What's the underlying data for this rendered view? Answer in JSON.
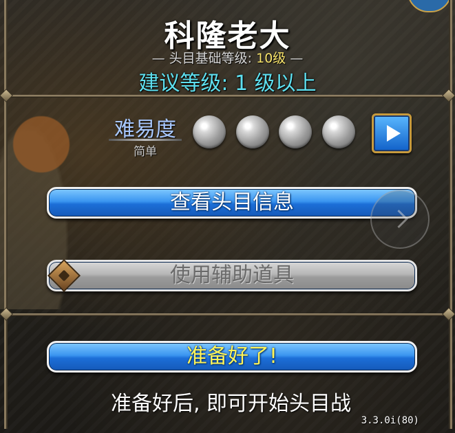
{
  "header": {
    "title": "科隆老大",
    "base_level_label": "头目基础等级:",
    "base_level_value": "10级",
    "recommend_text": "建议等级: 1 级以上"
  },
  "difficulty": {
    "label": "难易度",
    "value": "简单",
    "levels_total": 4,
    "levels_active": 0
  },
  "buttons": {
    "boss_info": "查看头目信息",
    "use_item": "使用辅助道具",
    "ready": "准备好了!"
  },
  "hint": "准备好后, 即可开始头目战",
  "version": "3.3.0i(80)",
  "colors": {
    "title": "#ffffff",
    "level_highlight": "#f7e36a",
    "recommend": "#5ee0f0",
    "button_blue": "#1c6fd8",
    "ready_text": "#fff45a"
  },
  "icons": {
    "next": "play-triangle-icon",
    "item": "item-gem-icon",
    "side": "chevron-right-icon"
  }
}
